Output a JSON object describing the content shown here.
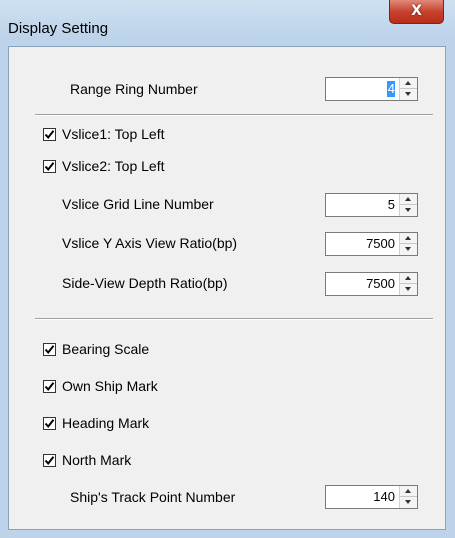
{
  "window": {
    "title": "Display Setting",
    "close_glyph": "X"
  },
  "range_ring": {
    "label": "Range Ring Number",
    "value": "4"
  },
  "vslice1": {
    "label": "Vslice1: Top Left",
    "checked": true
  },
  "vslice2": {
    "label": "Vslice2: Top Left",
    "checked": true
  },
  "vslice_grid": {
    "label": "Vslice Grid Line Number",
    "value": "5"
  },
  "vslice_y_ratio": {
    "label": "Vslice Y Axis View Ratio(bp)",
    "value": "7500"
  },
  "side_view_ratio": {
    "label": "Side-View Depth Ratio(bp)",
    "value": "7500"
  },
  "bearing_scale": {
    "label": "Bearing Scale",
    "checked": true
  },
  "own_ship_mark": {
    "label": "Own Ship Mark",
    "checked": true
  },
  "heading_mark": {
    "label": "Heading Mark",
    "checked": true
  },
  "north_mark": {
    "label": "North Mark",
    "checked": true
  },
  "track_points": {
    "label": "Ship's Track Point Number",
    "value": "140"
  }
}
